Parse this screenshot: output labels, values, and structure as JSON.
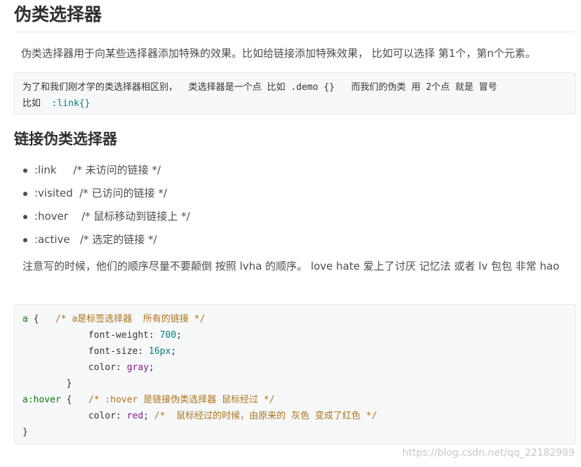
{
  "heading_main": "伪类选择器",
  "intro": "伪类选择器用于向某些选择器添加特殊的效果。比如给链接添加特殊效果， 比如可以选择 第1个，第n个元素。",
  "note_block": {
    "line1": "为了和我们刚才学的类选择器相区别，  类选择器是一个点 比如 .demo {}   而我们的伪类 用 2个点 就是 冒号",
    "line2_prefix": "比如  ",
    "line2_code": ":link{}"
  },
  "heading_links": "链接伪类选择器",
  "link_items": [
    ":link     /* 未访问的链接 */",
    ":visited  /* 已访问的链接 */",
    ":hover    /* 鼠标移动到链接上 */",
    ":active   /* 选定的链接 */"
  ],
  "order_note": "注意写的时候，他们的顺序尽量不要颠倒 按照 lvha 的顺序。  love  hate 爱上了讨厌 记忆法  或者  lv 包包 非常 hao",
  "code_example": {
    "l1_sel": "a",
    "l1_brace": " {   ",
    "l1_comment": "/* a是标签选择器  所有的链接 */",
    "l2_prop": "            font-weight: ",
    "l2_val": "700",
    "l3_prop": "            font-size: ",
    "l3_val": "16px",
    "l4_prop": "            color: ",
    "l4_val": "gray",
    "l5": "        }",
    "l6_sel": "a:hover",
    "l6_brace": " {   ",
    "l6_comment": "/* :hover 是链接伪类选择器 鼠标经过 */",
    "l7_prop": "            color: ",
    "l7_val": "red",
    "l7_sep": "; ",
    "l7_comment": "/*  鼠标经过的时候，由原来的 灰色 变成了红色 */",
    "l8": "}",
    "semicolon": ";"
  },
  "watermark": "https://blog.csdn.net/qq_22182989"
}
